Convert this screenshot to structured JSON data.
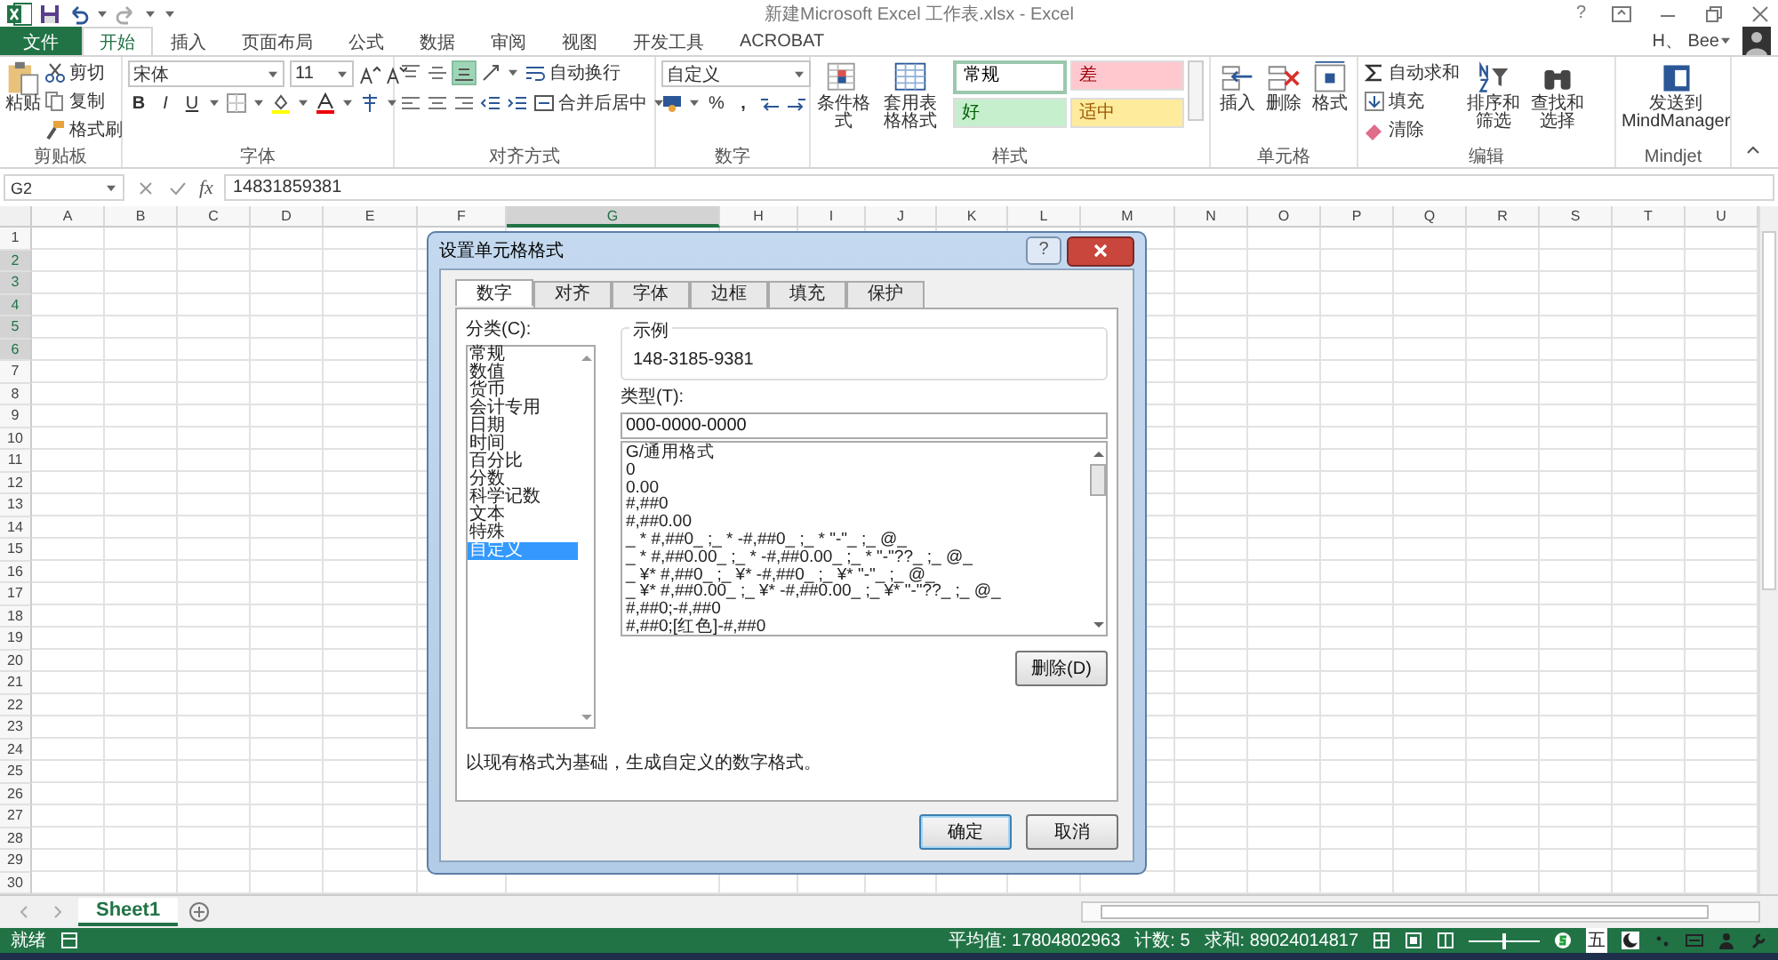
{
  "window": {
    "title": "新建Microsoft Excel 工作表.xlsx - Excel",
    "help_button": "?"
  },
  "tabs": [
    {
      "label": "文件",
      "kind": "file",
      "selected": false
    },
    {
      "label": "开始",
      "kind": "tab",
      "selected": true
    },
    {
      "label": "插入",
      "kind": "tab",
      "selected": false
    },
    {
      "label": "页面布局",
      "kind": "tab",
      "selected": false
    },
    {
      "label": "公式",
      "kind": "tab",
      "selected": false
    },
    {
      "label": "数据",
      "kind": "tab",
      "selected": false
    },
    {
      "label": "审阅",
      "kind": "tab",
      "selected": false
    },
    {
      "label": "视图",
      "kind": "tab",
      "selected": false
    },
    {
      "label": "开发工具",
      "kind": "tab",
      "selected": false
    },
    {
      "label": "ACROBAT",
      "kind": "tab",
      "selected": false
    }
  ],
  "account": {
    "name": "H、 Bee"
  },
  "ribbon": {
    "clipboard": {
      "label": "剪贴板",
      "paste": "粘贴",
      "cut": "剪切",
      "copy": "复制",
      "format_painter": "格式刷"
    },
    "font": {
      "label": "字体",
      "family": "宋体",
      "size": "11",
      "bold": "B",
      "italic": "I",
      "underline": "U"
    },
    "alignment": {
      "label": "对齐方式",
      "wrap_text": "自动换行",
      "merge_center": "合并后居中"
    },
    "number": {
      "label": "数字",
      "format": "自定义",
      "percent": "%",
      "comma": ","
    },
    "styles": {
      "label": "样式",
      "conditional_formatting": "条件格式",
      "format_as_table": "套用表格格式",
      "cell_styles": [
        {
          "label": "常规",
          "kind": "normal",
          "color": "#ffffff",
          "selected": true
        },
        {
          "label": "差",
          "kind": "bad",
          "color": "#ffc7ce",
          "selected": false
        },
        {
          "label": "好",
          "kind": "good",
          "color": "#c6efce",
          "selected": false
        },
        {
          "label": "适中",
          "kind": "neutral",
          "color": "#ffeb9c",
          "selected": false
        }
      ]
    },
    "cells": {
      "label": "单元格",
      "insert": "插入",
      "delete": "删除",
      "format": "格式"
    },
    "editing": {
      "label": "编辑",
      "autosum": "自动求和",
      "fill": "填充",
      "clear": "清除",
      "sort_filter": "排序和筛选",
      "find_select": "查找和选择"
    },
    "mindjet": {
      "label": "Mindjet",
      "send": "发送到 MindManager"
    }
  },
  "formula_bar": {
    "name_box": "G2",
    "function_label": "fx",
    "value": "14831859381"
  },
  "sheet": {
    "columns": [
      {
        "label": "A",
        "selected": false
      },
      {
        "label": "B",
        "selected": false
      },
      {
        "label": "C",
        "selected": false
      },
      {
        "label": "D",
        "selected": false
      },
      {
        "label": "E",
        "selected": false
      },
      {
        "label": "F",
        "selected": false
      },
      {
        "label": "G",
        "selected": true
      },
      {
        "label": "H",
        "selected": false
      },
      {
        "label": "I",
        "selected": false
      },
      {
        "label": "J",
        "selected": false
      },
      {
        "label": "K",
        "selected": false
      },
      {
        "label": "L",
        "selected": false
      },
      {
        "label": "M",
        "selected": false
      },
      {
        "label": "N",
        "selected": false
      },
      {
        "label": "O",
        "selected": false
      },
      {
        "label": "P",
        "selected": false
      },
      {
        "label": "Q",
        "selected": false
      },
      {
        "label": "R",
        "selected": false
      },
      {
        "label": "S",
        "selected": false
      },
      {
        "label": "T",
        "selected": false
      },
      {
        "label": "U",
        "selected": false
      }
    ],
    "rows": [
      {
        "label": "1",
        "selected": false
      },
      {
        "label": "2",
        "selected": true
      },
      {
        "label": "3",
        "selected": true
      },
      {
        "label": "4",
        "selected": true
      },
      {
        "label": "5",
        "selected": true
      },
      {
        "label": "6",
        "selected": true
      },
      {
        "label": "7",
        "selected": false
      },
      {
        "label": "8",
        "selected": false
      },
      {
        "label": "9",
        "selected": false
      },
      {
        "label": "10",
        "selected": false
      },
      {
        "label": "11",
        "selected": false
      },
      {
        "label": "12",
        "selected": false
      },
      {
        "label": "13",
        "selected": false
      },
      {
        "label": "14",
        "selected": false
      },
      {
        "label": "15",
        "selected": false
      },
      {
        "label": "16",
        "selected": false
      },
      {
        "label": "17",
        "selected": false
      },
      {
        "label": "18",
        "selected": false
      },
      {
        "label": "19",
        "selected": false
      },
      {
        "label": "20",
        "selected": false
      },
      {
        "label": "21",
        "selected": false
      },
      {
        "label": "22",
        "selected": false
      },
      {
        "label": "23",
        "selected": false
      },
      {
        "label": "24",
        "selected": false
      },
      {
        "label": "25",
        "selected": false
      },
      {
        "label": "26",
        "selected": false
      },
      {
        "label": "27",
        "selected": false
      },
      {
        "label": "28",
        "selected": false
      },
      {
        "label": "29",
        "selected": false
      },
      {
        "label": "30",
        "selected": false
      }
    ]
  },
  "sheet_tabs": [
    {
      "label": "Sheet1",
      "selected": true
    }
  ],
  "status_bar": {
    "ready": "就绪",
    "average": "平均值: 17804802963",
    "count": "计数: 5",
    "sum": "求和: 89024014817",
    "zoom": {
      "level": 0.5
    },
    "ime": "五"
  },
  "dialog": {
    "title": "设置单元格格式",
    "help_button": "?",
    "tabs": [
      {
        "label": "数字",
        "selected": true
      },
      {
        "label": "对齐",
        "selected": false
      },
      {
        "label": "字体",
        "selected": false
      },
      {
        "label": "边框",
        "selected": false
      },
      {
        "label": "填充",
        "selected": false
      },
      {
        "label": "保护",
        "selected": false
      }
    ],
    "category_label": "分类(C):",
    "categories": [
      {
        "label": "常规",
        "selected": false
      },
      {
        "label": "数值",
        "selected": false
      },
      {
        "label": "货币",
        "selected": false
      },
      {
        "label": "会计专用",
        "selected": false
      },
      {
        "label": "日期",
        "selected": false
      },
      {
        "label": "时间",
        "selected": false
      },
      {
        "label": "百分比",
        "selected": false
      },
      {
        "label": "分数",
        "selected": false
      },
      {
        "label": "科学记数",
        "selected": false
      },
      {
        "label": "文本",
        "selected": false
      },
      {
        "label": "特殊",
        "selected": false
      },
      {
        "label": "自定义",
        "selected": true
      }
    ],
    "sample_label": "示例",
    "sample": "148-3185-9381",
    "type_label": "类型(T):",
    "type_value": "000-0000-0000",
    "formats": [
      "G/通用格式",
      "0",
      "0.00",
      "#,##0",
      "#,##0.00",
      "_ * #,##0_ ;_ * -#,##0_ ;_ * \"-\"_ ;_ @_",
      "_ * #,##0.00_ ;_ * -#,##0.00_ ;_ * \"-\"??_ ;_ @_",
      "_ ¥* #,##0_ ;_ ¥* -#,##0_ ;_ ¥* \"-\"_ ;_ @_",
      "_ ¥* #,##0.00_ ;_ ¥* -#,##0.00_ ;_ ¥* \"-\"??_ ;_ @_",
      "#,##0;-#,##0",
      "#,##0;[红色]-#,##0"
    ],
    "delete_button": "删除(D)",
    "description": "以现有格式为基础，生成自定义的数字格式。",
    "ok_button": "确定",
    "cancel_button": "取消"
  }
}
